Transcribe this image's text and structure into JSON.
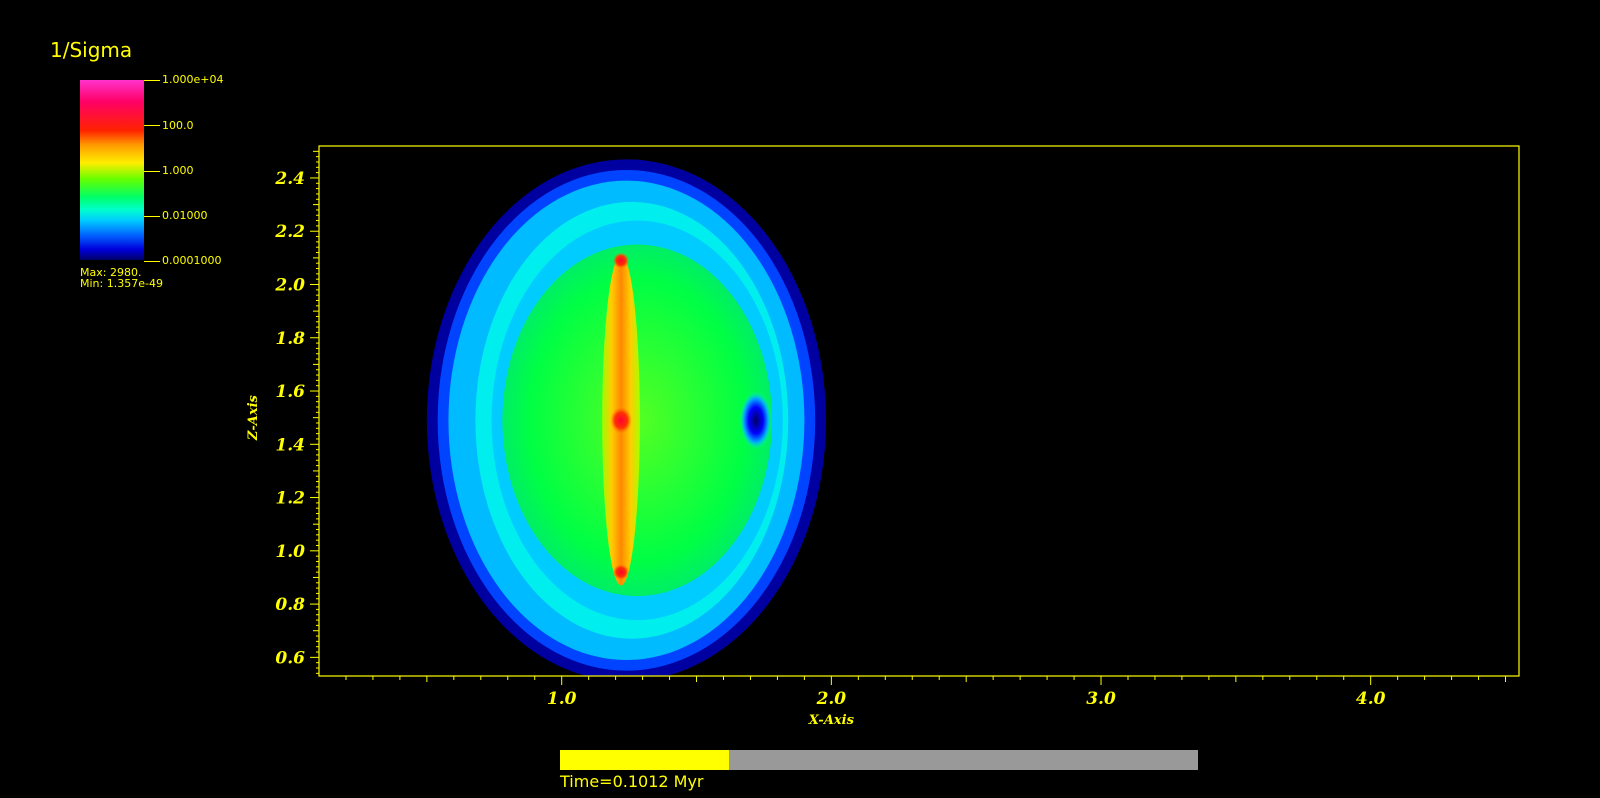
{
  "legend": {
    "title": "1/Sigma",
    "ticks": [
      "1.000e+04",
      "100.0",
      "1.000",
      "0.01000",
      "0.0001000"
    ],
    "max_label": "Max:  2980.",
    "min_label": "Min:  1.357e-49"
  },
  "time": {
    "label": "Time=0.1012 Myr",
    "progress": 0.265
  },
  "chart_data": {
    "type": "heatmap",
    "xlabel": "X-Axis",
    "ylabel": "Z-Axis",
    "xlim": [
      0.1,
      4.55
    ],
    "ylim": [
      0.53,
      2.52
    ],
    "x_ticks": [
      "1.0",
      "2.0",
      "3.0",
      "4.0"
    ],
    "y_ticks": [
      "0.6",
      "0.8",
      "1.0",
      "1.2",
      "1.4",
      "1.6",
      "1.8",
      "2.0",
      "2.2",
      "2.4"
    ],
    "colormap": "log scale 1e-4 to 1e4: dark blue, blue, cyan, green, yellow, orange, red, magenta",
    "color_scale": "log",
    "value_range": [
      0.0001,
      10000
    ],
    "background": "#000000",
    "axis_color": "#ffff00"
  }
}
